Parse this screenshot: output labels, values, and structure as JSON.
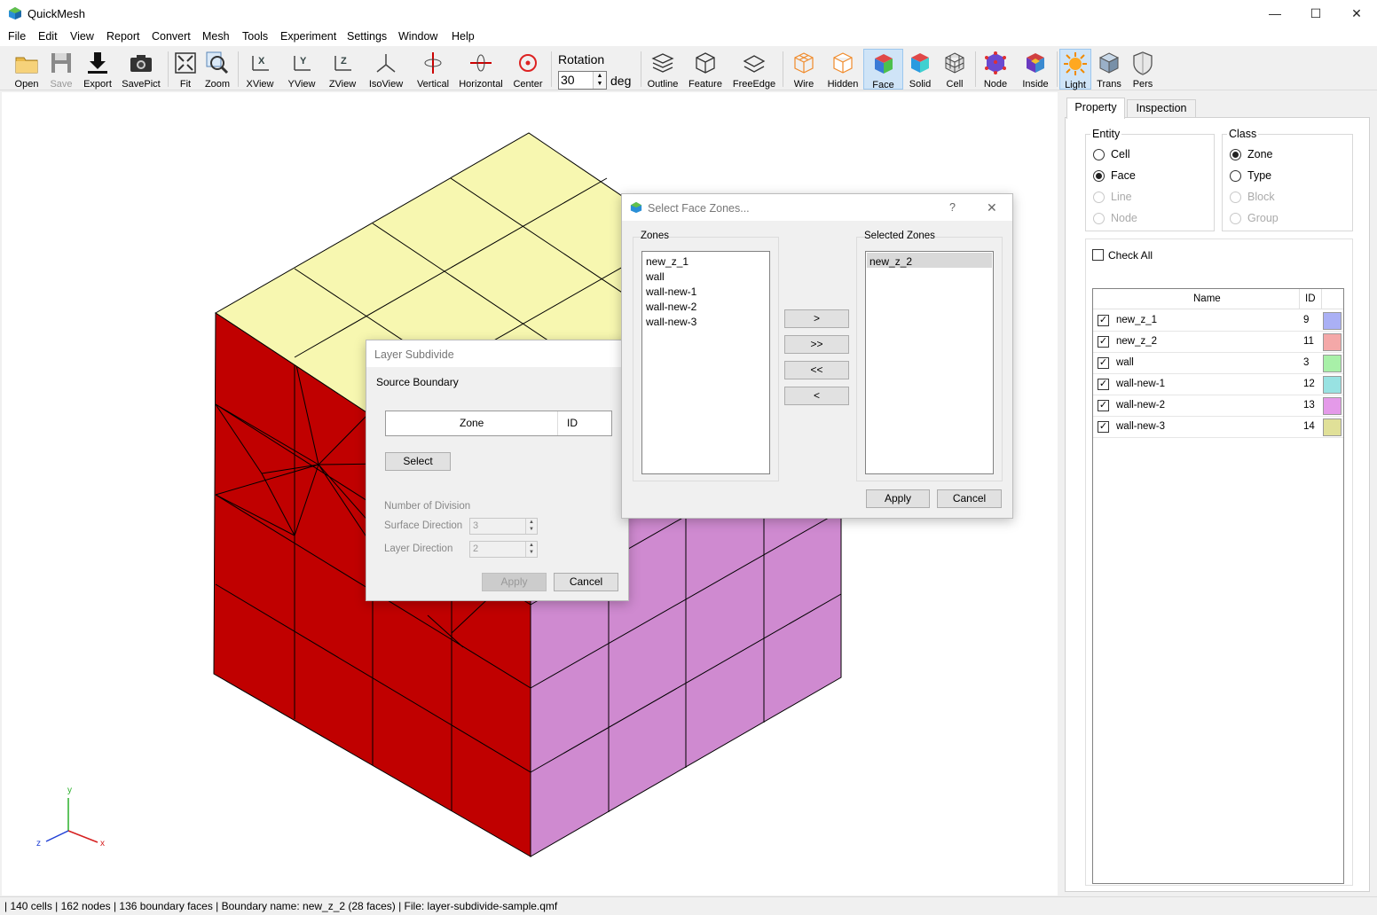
{
  "window": {
    "title": "QuickMesh",
    "minimize": "—",
    "maximize": "☐",
    "close": "✕"
  },
  "menu": [
    "File",
    "Edit",
    "View",
    "Report",
    "Convert",
    "Mesh",
    "Tools",
    "Experiment",
    "Settings",
    "Window",
    "Help"
  ],
  "toolbar": {
    "open": "Open",
    "save": "Save",
    "export": "Export",
    "savepict": "SavePict",
    "fit": "Fit",
    "zoom": "Zoom",
    "xview": "XView",
    "yview": "YView",
    "zview": "ZView",
    "isoview": "IsoView",
    "vertical": "Vertical",
    "horizontal": "Horizontal",
    "center": "Center",
    "rotation_label": "Rotation",
    "rotation_value": "30",
    "rotation_unit": "deg",
    "outline": "Outline",
    "feature": "Feature",
    "freeedge": "FreeEdge",
    "wire": "Wire",
    "hidden": "Hidden",
    "face": "Face",
    "solid": "Solid",
    "cell": "Cell",
    "node": "Node",
    "inside": "Inside",
    "light": "Light",
    "trans": "Trans",
    "pers": "Pers"
  },
  "axes": {
    "x": "x",
    "y": "y",
    "z": "z"
  },
  "panel": {
    "tabs": [
      "Property",
      "Inspection"
    ],
    "entity": {
      "title": "Entity",
      "options": [
        "Cell",
        "Face",
        "Line",
        "Node"
      ],
      "selected": "Face"
    },
    "class": {
      "title": "Class",
      "options": [
        "Zone",
        "Type",
        "Block",
        "Group"
      ],
      "selected": "Zone"
    },
    "check_all": "Check All",
    "table": {
      "headers": {
        "name": "Name",
        "id": "ID"
      },
      "rows": [
        {
          "name": "new_z_1",
          "id": "9",
          "color": "#aab0f5"
        },
        {
          "name": "new_z_2",
          "id": "11",
          "color": "#f4a8a8"
        },
        {
          "name": "wall",
          "id": "3",
          "color": "#a8f0a8"
        },
        {
          "name": "wall-new-1",
          "id": "12",
          "color": "#98e2e2"
        },
        {
          "name": "wall-new-2",
          "id": "13",
          "color": "#e49ae9"
        },
        {
          "name": "wall-new-3",
          "id": "14",
          "color": "#e0e098"
        }
      ]
    }
  },
  "layer_dialog": {
    "title": "Layer Subdivide",
    "source_boundary": "Source Boundary",
    "col_zone": "Zone",
    "col_id": "ID",
    "select": "Select",
    "num_division": "Number of Division",
    "surface_direction": "Surface Direction",
    "surface_value": "3",
    "layer_direction": "Layer Direction",
    "layer_value": "2",
    "apply": "Apply",
    "cancel": "Cancel"
  },
  "zones_dialog": {
    "title": "Select Face Zones...",
    "help": "?",
    "close": "✕",
    "zones_label": "Zones",
    "selected_label": "Selected Zones",
    "zones": [
      "new_z_1",
      "wall",
      "wall-new-1",
      "wall-new-2",
      "wall-new-3"
    ],
    "selected": [
      "new_z_2"
    ],
    "add": ">",
    "add_all": ">>",
    "remove_all": "<<",
    "remove": "<",
    "apply": "Apply",
    "cancel": "Cancel"
  },
  "status": "| 140 cells | 162 nodes | 136 boundary faces |  Boundary name: new_z_2 (28 faces) | File: layer-subdivide-sample.qmf",
  "colors": {
    "top_face": "#f7f7b0",
    "left_face": "#c00000",
    "right_face": "#cf8ad0",
    "accent": "#cfe4f7"
  }
}
